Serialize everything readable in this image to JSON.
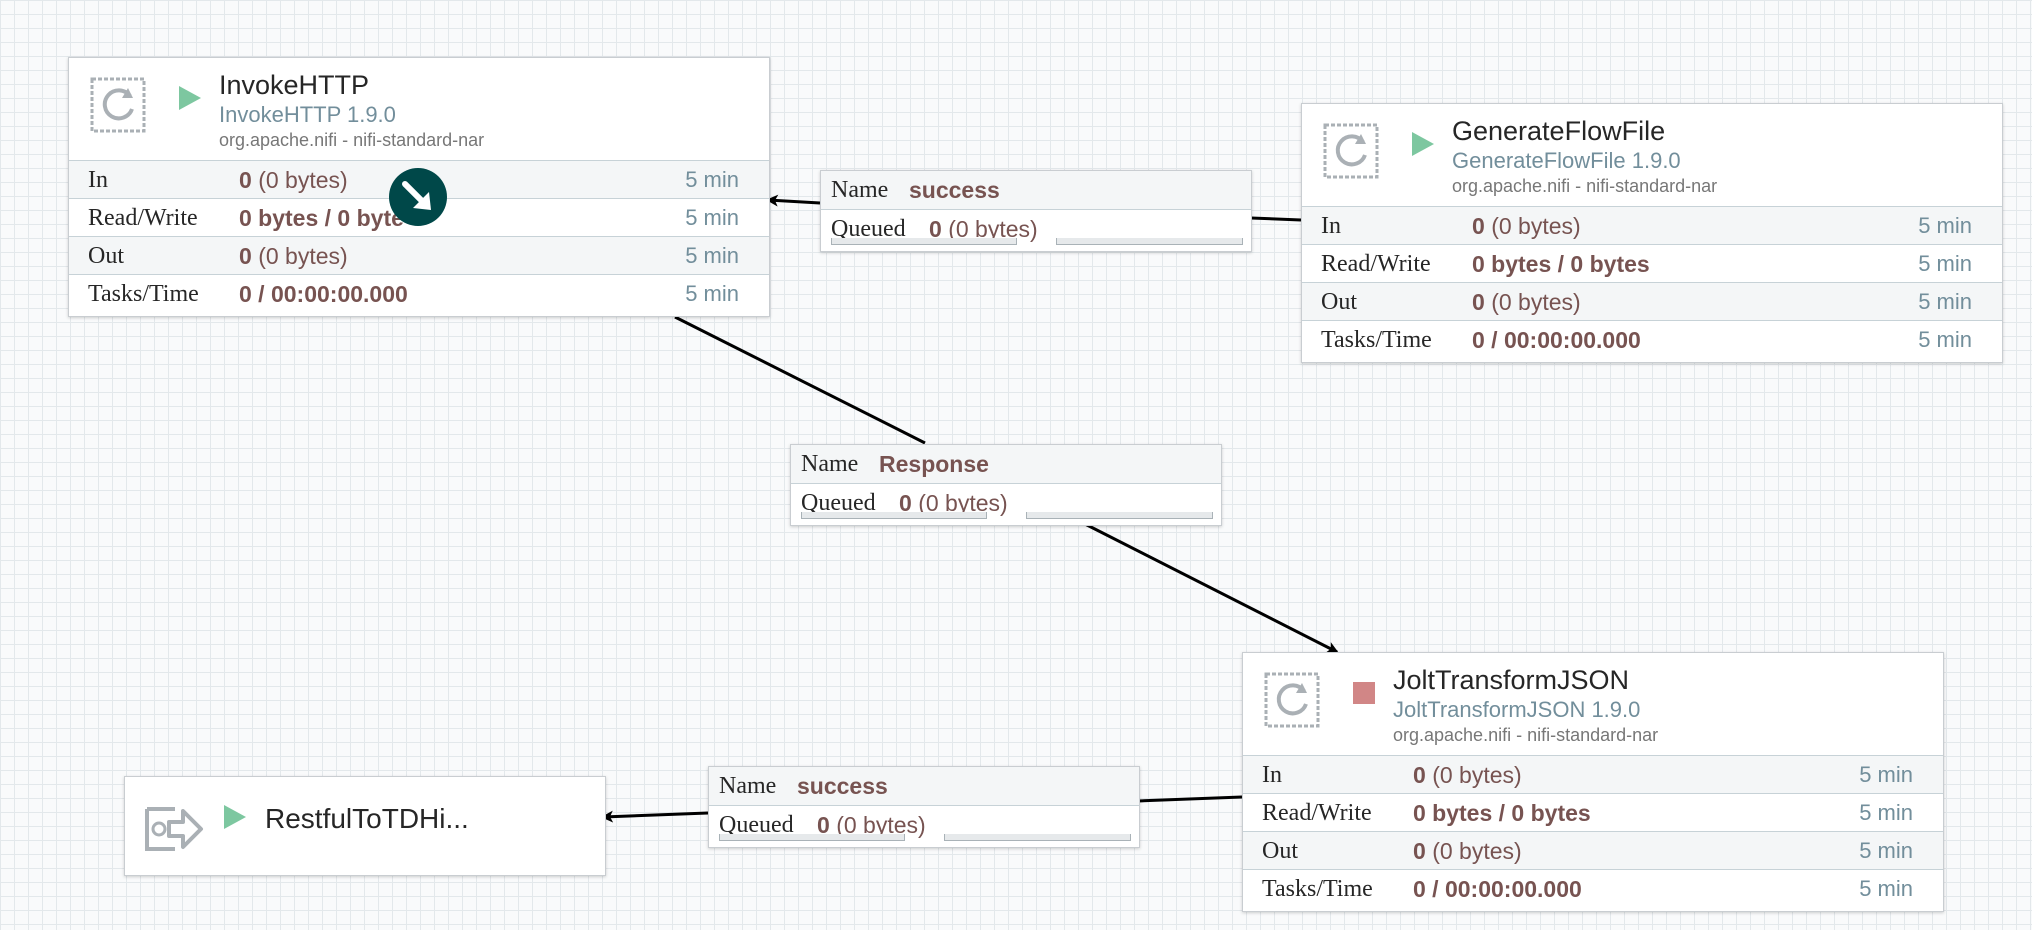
{
  "processors": {
    "invoke_http": {
      "name": "InvokeHTTP",
      "type": "InvokeHTTP 1.9.0",
      "bundle": "org.apache.nifi - nifi-standard-nar",
      "state": "running",
      "in_value": "0",
      "in_size": "(0 bytes)",
      "rw_value": "0 bytes / 0 byte",
      "out_value": "0",
      "out_size": "(0 bytes)",
      "tasks_value": "0 / 00:00:00.000"
    },
    "generate_flowfile": {
      "name": "GenerateFlowFile",
      "type": "GenerateFlowFile 1.9.0",
      "bundle": "org.apache.nifi - nifi-standard-nar",
      "state": "running",
      "in_value": "0",
      "in_size": "(0 bytes)",
      "rw_value": "0 bytes / 0 bytes",
      "out_value": "0",
      "out_size": "(0 bytes)",
      "tasks_value": "0 / 00:00:00.000"
    },
    "jolt_transform": {
      "name": "JoltTransformJSON",
      "type": "JoltTransformJSON 1.9.0",
      "bundle": "org.apache.nifi - nifi-standard-nar",
      "state": "stopped",
      "in_value": "0",
      "in_size": "(0 bytes)",
      "rw_value": "0 bytes / 0 bytes",
      "out_value": "0",
      "out_size": "(0 bytes)",
      "tasks_value": "0 / 00:00:00.000"
    }
  },
  "stat_labels": {
    "in": "In",
    "read_write": "Read/Write",
    "out": "Out",
    "tasks_time": "Tasks/Time",
    "window": "5 min"
  },
  "connections": {
    "name_label": "Name",
    "queued_label": "Queued",
    "gen_to_invoke": {
      "name": "success",
      "queued_count": "0",
      "queued_size": "(0 bytes)"
    },
    "invoke_to_jolt": {
      "name": "Response",
      "queued_count": "0",
      "queued_size": "(0 bytes)"
    },
    "jolt_to_port": {
      "name": "success",
      "queued_count": "0",
      "queued_size": "(0 bytes)"
    }
  },
  "output_port": {
    "name": "RestfulToTDHi...",
    "state": "running"
  },
  "icons": {
    "processor": "processor-icon",
    "running": "play-icon",
    "stopped": "stop-icon",
    "output_port": "output-port-icon",
    "cursor": "drag-cursor-icon"
  },
  "colors": {
    "running": "#7dc7a0",
    "stopped": "#d18686",
    "value": "#775351",
    "type": "#728e9b",
    "cursor": "#004849"
  }
}
